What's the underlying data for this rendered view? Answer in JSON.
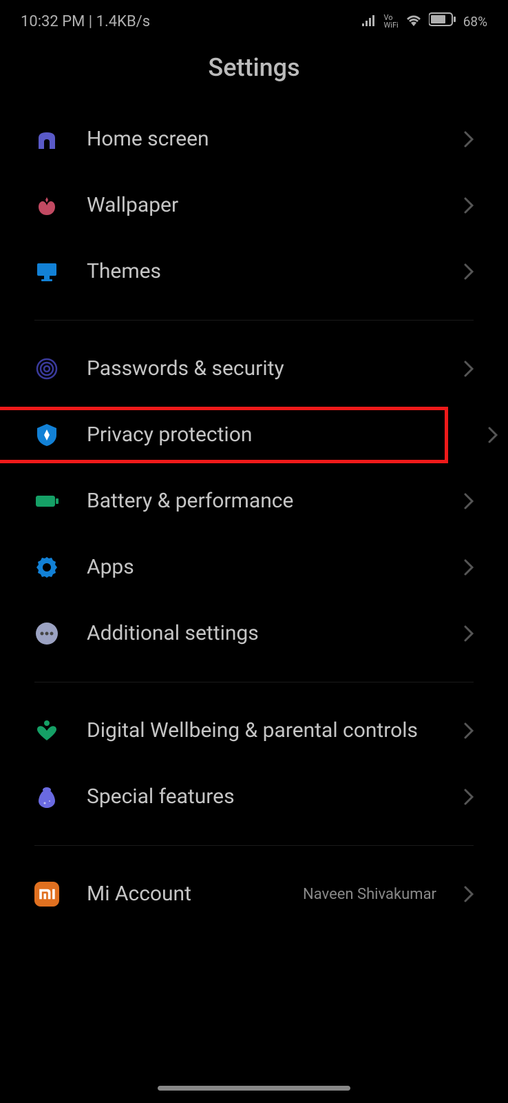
{
  "status": {
    "time": "10:32 PM",
    "netspeed": "1.4KB/s",
    "battery": "68%"
  },
  "title": "Settings",
  "groups": [
    [
      {
        "id": "home-screen",
        "label": "Home screen",
        "icon": "home",
        "color": "#5a5ac8",
        "highlight": false
      },
      {
        "id": "wallpaper",
        "label": "Wallpaper",
        "icon": "wallpaper",
        "color": "#c24a62",
        "highlight": false
      },
      {
        "id": "themes",
        "label": "Themes",
        "icon": "themes",
        "color": "#1281d6",
        "highlight": false
      }
    ],
    [
      {
        "id": "passwords-security",
        "label": "Passwords & security",
        "icon": "fingerprint",
        "color": "#3a3a9c",
        "highlight": false
      },
      {
        "id": "privacy-protection",
        "label": "Privacy protection",
        "icon": "shield",
        "color": "#1281d6",
        "highlight": true
      },
      {
        "id": "battery-performance",
        "label": "Battery & performance",
        "icon": "battery",
        "color": "#15a066",
        "highlight": false
      },
      {
        "id": "apps",
        "label": "Apps",
        "icon": "gear",
        "color": "#1281d6",
        "highlight": false
      },
      {
        "id": "additional-settings",
        "label": "Additional settings",
        "icon": "more",
        "color": "#9ba2c2",
        "highlight": false
      }
    ],
    [
      {
        "id": "digital-wellbeing",
        "label": "Digital Wellbeing & parental controls",
        "icon": "heart",
        "color": "#15a066",
        "highlight": false
      },
      {
        "id": "special-features",
        "label": "Special features",
        "icon": "flask",
        "color": "#6a6ae0",
        "highlight": false
      }
    ],
    [
      {
        "id": "mi-account",
        "label": "Mi Account",
        "icon": "mi",
        "color": "#e07020",
        "highlight": false,
        "value": "Naveen Shivakumar"
      }
    ]
  ]
}
